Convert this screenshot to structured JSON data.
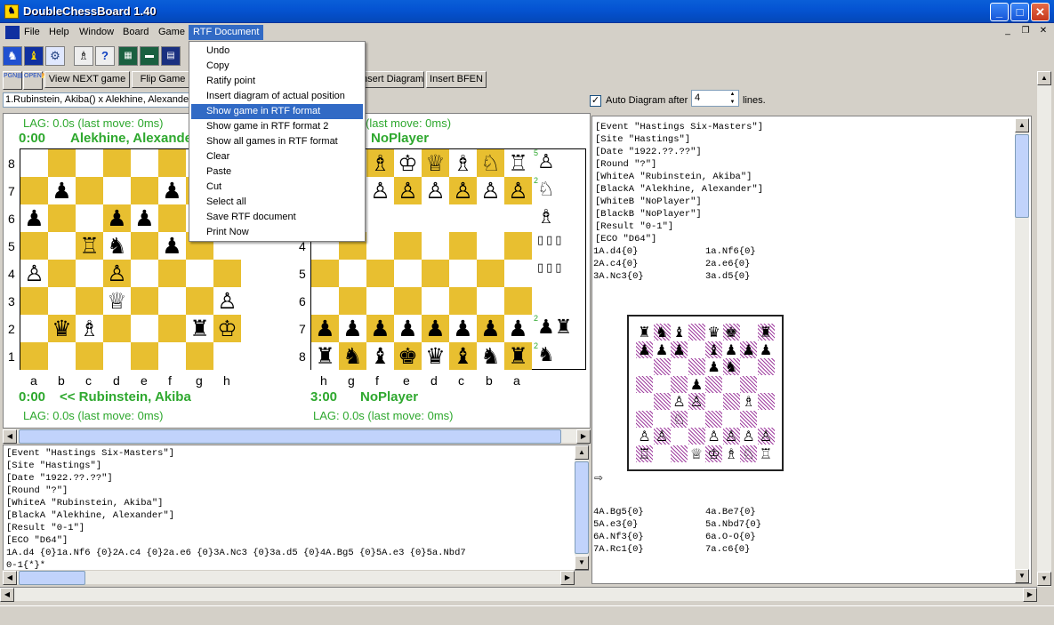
{
  "window": {
    "title": "DoubleChessBoard 1.40",
    "min": "_",
    "max": "□",
    "close": "✕",
    "mdi_min": "_",
    "mdi_restore": "❐",
    "mdi_close": "✕"
  },
  "menubar": [
    "File",
    "Help",
    "Window",
    "Board",
    "Game",
    "RTF Document"
  ],
  "toolbar": {
    "pgn_btn1": "PGN",
    "pgn_btn2": "OPEN",
    "view_next": "View NEXT game",
    "flip": "Flip Game",
    "insert_diagram": "Insert Diagram",
    "insert_bfen": "Insert BFEN"
  },
  "game_combo": "1.Rubinstein, Akiba() x Alekhine, Alexander()",
  "auto_diagram": {
    "label_before": "Auto Diagram after :",
    "value": "4",
    "label_after": "lines.",
    "checked": true
  },
  "dropdown": [
    "Undo",
    "Copy",
    "Ratify point",
    "Insert diagram of actual position",
    "Show game in RTF format",
    "Show game in RTF format 2",
    "Show all games in RTF format",
    "Clear",
    "Paste",
    "Cut",
    "Select all",
    "Save RTF document",
    "Print Now"
  ],
  "dropdown_selected": 4,
  "boardA": {
    "lag_top": "LAG: 0.0s (last move: 0ms)",
    "clock_top": "0:00",
    "player_top": "Alekhine, Alexander",
    "lag_bottom": "LAG: 0.0s (last move: 0ms)",
    "clock_bottom": "0:00",
    "player_bottom": "<< Rubinstein, Akiba",
    "ranks": [
      "8",
      "7",
      "6",
      "5",
      "4",
      "3",
      "2",
      "1"
    ],
    "files": [
      "a",
      "b",
      "c",
      "d",
      "e",
      "f",
      "g",
      "h"
    ],
    "rows": [
      "........",
      ".♟...♟♟.",
      "♟..♟♟...",
      "..♖♞.♟..",
      "♙..♙....",
      "...♕...♙",
      ".♛♗...♜♔",
      "........"
    ]
  },
  "boardB": {
    "lag_top": "(last move: 0ms)",
    "clock_top": "",
    "player_top": "NoPlayer",
    "lag_bottom": "LAG: 0.0s (last move: 0ms)",
    "clock_bottom": "3:00",
    "player_bottom": "NoPlayer",
    "ranks": [
      "4",
      "5",
      "6",
      "7",
      "8"
    ],
    "files": [
      "h",
      "g",
      "f",
      "e",
      "d",
      "c",
      "b",
      "a"
    ],
    "top_rows": [
      "..♗♔♕♗♘♖",
      "..♙♙♙♙♙♙"
    ],
    "rows": [
      "........",
      "........",
      "........",
      "♟♟♟♟♟♟♟♟",
      "♜♞♝♚♛♝♞♜"
    ]
  },
  "reserve": {
    "counts": [
      "5",
      "2",
      "",
      "",
      "",
      "",
      "2",
      "2"
    ],
    "pieces": [
      "♙",
      "♘",
      "♗",
      "▯▯▯",
      "▯▯▯",
      "",
      "♟♜",
      "♞"
    ]
  },
  "pgn_bottom_lines": [
    "[Event \"Hastings Six-Masters\"]",
    "[Site \"Hastings\"]",
    "[Date \"1922.??.??\"]",
    "[Round \"?\"]",
    "[WhiteA \"Rubinstein, Akiba\"]",
    "[BlackA \"Alekhine, Alexander\"]",
    "[Result \"0-1\"]",
    "[ECO \"D64\"]",
    "1A.d4 {0}1a.Nf6 {0}2A.c4 {0}2a.e6 {0}3A.Nc3 {0}3a.d5 {0}4A.Bg5 {0}5A.e3 {0}5a.Nbd7",
    "0-1{*}*"
  ],
  "rtf_header": [
    "[Event \"Hastings Six-Masters\"]",
    "[Site \"Hastings\"]",
    "[Date \"1922.??.??\"]",
    "[Round \"?\"]",
    "[WhiteA \"Rubinstein, Akiba\"]",
    "[BlackA \"Alekhine, Alexander\"]",
    "[WhiteB \"NoPlayer\"]",
    "[BlackB \"NoPlayer\"]",
    "[Result \"0-1\"]",
    "[ECO \"D64\"]"
  ],
  "rtf_moves_1": [
    [
      "1A.d4{0}",
      "1a.Nf6{0}"
    ],
    [
      "2A.c4{0}",
      "2a.e6{0}"
    ],
    [
      "3A.Nc3{0}",
      "3a.d5{0}"
    ]
  ],
  "rtf_moves_2": [
    [
      "4A.Bg5{0}",
      "4a.Be7{0}"
    ],
    [
      "5A.e3{0}",
      "5a.Nbd7{0}"
    ],
    [
      "6A.Nf3{0}",
      "6a.O-O{0}"
    ],
    [
      "7A.Rc1{0}",
      "7a.c6{0}"
    ]
  ],
  "rtf_arrow": "⇨",
  "diagram_rows": [
    "♜♞♝♛♚♝♞♜",
    "♟♟♟♟♟♟♟♟",
    ".....♞..",
    "....♟...",
    "...♙....",
    "..♘.....",
    "♙♙..♙♙♙♙",
    "♖.♗♕♔♗♘♖"
  ],
  "diagram_placement": [
    "♜♞♝.♛♚.♜",
    "♟♟♟.♝♟♟♟",
    "....♟♞..",
    "...♟....",
    "..♙♙..♗.",
    "..♘.....",
    "♙♙..♙♙♙♙",
    "♖..♕♔♗♘♖"
  ]
}
